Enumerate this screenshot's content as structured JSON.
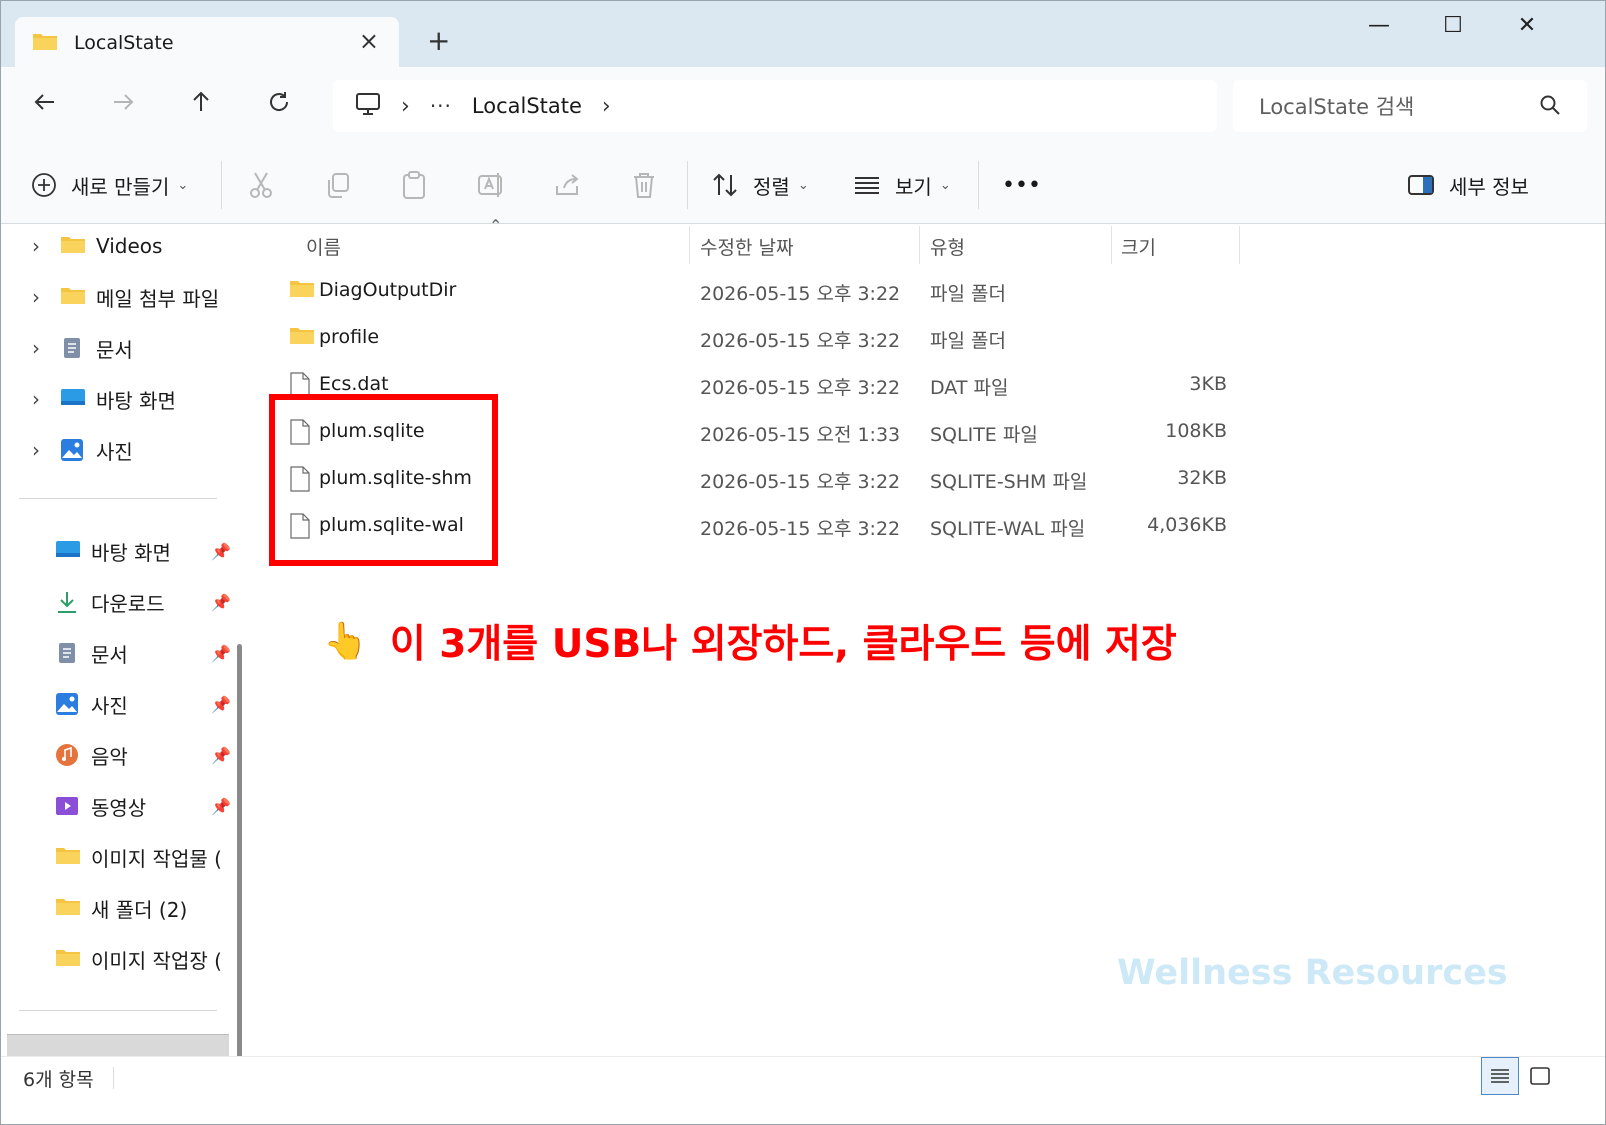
{
  "window": {
    "tab_title": "LocalState",
    "new_tab": "+",
    "close_tab": "×",
    "minimize": "—",
    "maximize": "☐",
    "close": "✕"
  },
  "address": {
    "crumb_more": "···",
    "crumb_current": "LocalState",
    "search_placeholder": "LocalState 검색"
  },
  "toolbar": {
    "new_label": "새로 만들기",
    "sort_label": "정렬",
    "view_label": "보기",
    "more_label": "•••",
    "details_label": "세부 정보"
  },
  "sidebar": {
    "tree": [
      {
        "label": "Videos",
        "icon": "folder-icon"
      },
      {
        "label": "메일 첨부 파일",
        "icon": "folder-icon"
      },
      {
        "label": "문서",
        "icon": "document-icon"
      },
      {
        "label": "바탕 화면",
        "icon": "desktop-icon"
      },
      {
        "label": "사진",
        "icon": "pictures-icon"
      }
    ],
    "quick": [
      {
        "label": "바탕 화면",
        "icon": "desktop-icon",
        "pinned": true
      },
      {
        "label": "다운로드",
        "icon": "download-icon",
        "pinned": true
      },
      {
        "label": "문서",
        "icon": "document-icon",
        "pinned": true
      },
      {
        "label": "사진",
        "icon": "pictures-icon",
        "pinned": true
      },
      {
        "label": "음악",
        "icon": "music-icon",
        "pinned": true
      },
      {
        "label": "동영상",
        "icon": "video-icon",
        "pinned": true
      },
      {
        "label": "이미지 작업물 (",
        "icon": "folder-icon",
        "pinned": false
      },
      {
        "label": "새 폴더 (2)",
        "icon": "folder-icon",
        "pinned": false
      },
      {
        "label": "이미지 작업장 (",
        "icon": "folder-icon",
        "pinned": false
      }
    ]
  },
  "columns": {
    "name": "이름",
    "modified": "수정한 날짜",
    "type": "유형",
    "size": "크기"
  },
  "files": [
    {
      "name": "DiagOutputDir",
      "modified": "2026-05-15 오후 3:22",
      "type": "파일 폴더",
      "size": "",
      "icon": "folder-icon"
    },
    {
      "name": "profile",
      "modified": "2026-05-15 오후 3:22",
      "type": "파일 폴더",
      "size": "",
      "icon": "folder-icon"
    },
    {
      "name": "Ecs.dat",
      "modified": "2026-05-15 오후 3:22",
      "type": "DAT 파일",
      "size": "3KB",
      "icon": "file-icon"
    },
    {
      "name": "plum.sqlite",
      "modified": "2026-05-15 오전 1:33",
      "type": "SQLITE 파일",
      "size": "108KB",
      "icon": "file-icon"
    },
    {
      "name": "plum.sqlite-shm",
      "modified": "2026-05-15 오후 3:22",
      "type": "SQLITE-SHM 파일",
      "size": "32KB",
      "icon": "file-icon"
    },
    {
      "name": "plum.sqlite-wal",
      "modified": "2026-05-15 오후 3:22",
      "type": "SQLITE-WAL 파일",
      "size": "4,036KB",
      "icon": "file-icon"
    }
  ],
  "annotation": {
    "hand": "👆",
    "text": "이 3개를 USB나 외장하드, 클라우드 등에 저장"
  },
  "watermark": "Wellness Resources",
  "status": {
    "count": "6개 항목"
  },
  "colors": {
    "annotation": "#ff0000",
    "folder": "#f4c542",
    "accent": "#4d88c8"
  }
}
